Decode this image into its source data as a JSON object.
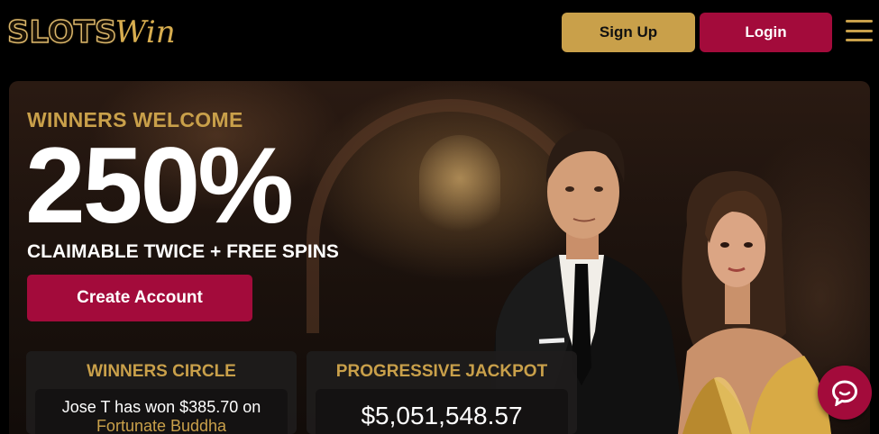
{
  "brand": {
    "logo_text_a": "SLOTS",
    "logo_text_b": "Win"
  },
  "header": {
    "signup_label": "Sign Up",
    "login_label": "Login",
    "menu_icon": "hamburger-menu-icon"
  },
  "hero": {
    "headline": "WINNERS WELCOME",
    "bonus_percent": "250%",
    "subline": "CLAIMABLE TWICE + FREE SPINS",
    "cta_label": "Create Account"
  },
  "winners_circle": {
    "title": "WINNERS CIRCLE",
    "winner_text": "Jose T has won $385.70 on",
    "game_name": "Fortunate Buddha"
  },
  "progressive_jackpot": {
    "title": "PROGRESSIVE JACKPOT",
    "amount": "$5,051,548.57"
  },
  "chat": {
    "icon": "chat-bubble-icon"
  },
  "colors": {
    "gold": "#c9a04a",
    "crimson": "#a30b3b",
    "background": "#000000"
  }
}
